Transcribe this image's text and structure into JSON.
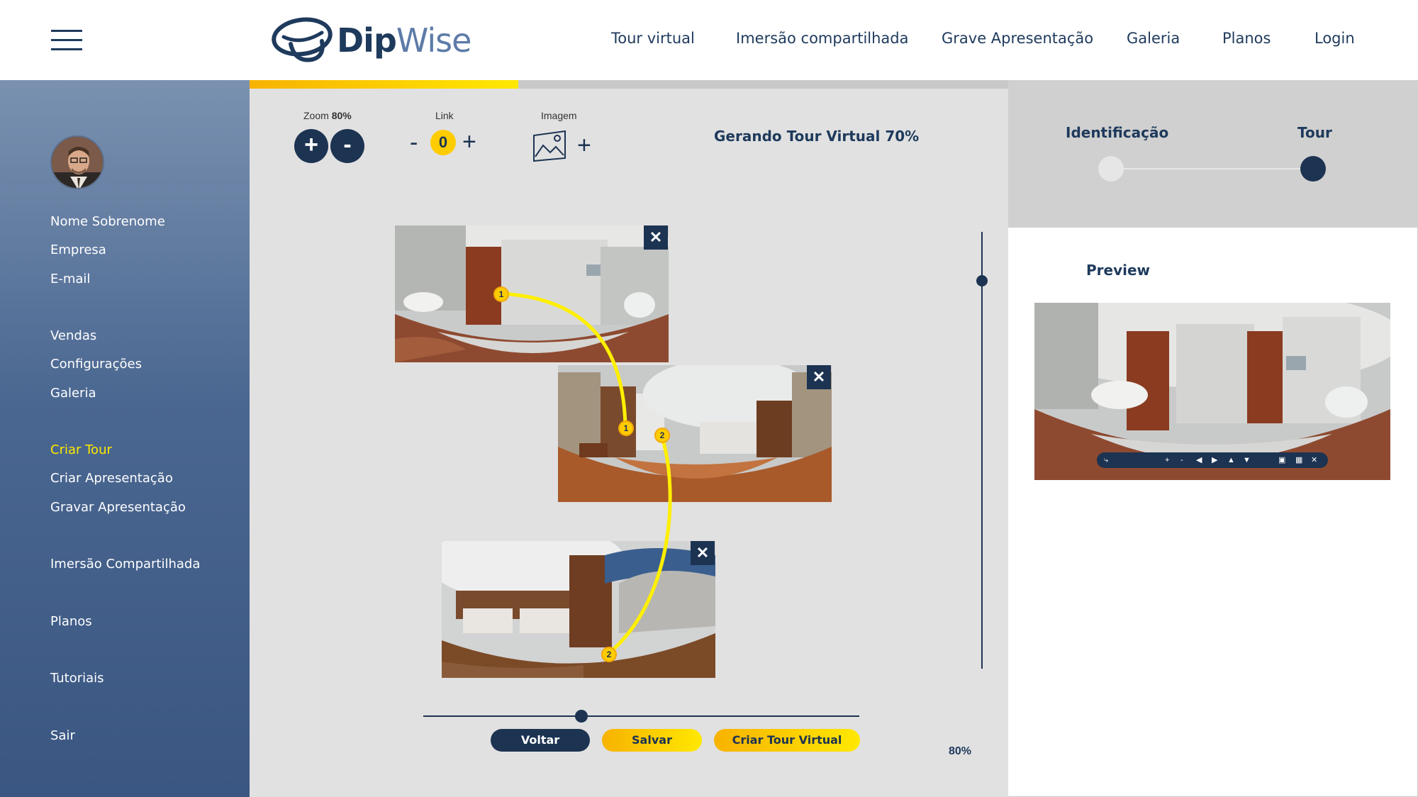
{
  "header": {
    "logo_main": "Dip",
    "logo_accent": "Wise",
    "nav": [
      {
        "label": "Tour virtual"
      },
      {
        "label": "Imersão compartilhada"
      },
      {
        "label": "Grave Apresentação"
      },
      {
        "label": "Galeria"
      },
      {
        "label": "Planos"
      },
      {
        "label": "Login"
      }
    ]
  },
  "sidebar": {
    "items": [
      {
        "label": "Nome Sobrenome"
      },
      {
        "label": "Empresa"
      },
      {
        "label": "E-mail"
      },
      {
        "label": "Vendas"
      },
      {
        "label": "Configurações"
      },
      {
        "label": "Galeria"
      },
      {
        "label": "Criar Tour",
        "active": true
      },
      {
        "label": "Criar Apresentação"
      },
      {
        "label": "Gravar Apresentação"
      },
      {
        "label": "Imersão Compartilhada"
      },
      {
        "label": "Planos"
      },
      {
        "label": "Tutoriais"
      },
      {
        "label": "Sair"
      }
    ]
  },
  "toolbar": {
    "zoom_label": "Zoom",
    "zoom_value": "80%",
    "zoom_in": "+",
    "zoom_out": "-",
    "link_label": "Link",
    "link_minus": "-",
    "link_count": "0",
    "link_plus": "+",
    "image_label": "Imagem",
    "image_plus": "+"
  },
  "progress": {
    "fraction": 0.7,
    "status_text": "Gerando Tour Virtual 70%"
  },
  "panoramas": [
    {
      "close": "✕",
      "pins": [
        "1"
      ]
    },
    {
      "close": "✕",
      "pins": [
        "1",
        "2"
      ]
    },
    {
      "close": "✕",
      "pins": [
        "2"
      ]
    }
  ],
  "actions": {
    "back": "Voltar",
    "save": "Salvar",
    "create": "Criar Tour Virtual"
  },
  "zoom_readout": "80%",
  "steps": {
    "step1": "Identificação",
    "step2": "Tour",
    "current": 2
  },
  "preview": {
    "title": "Preview",
    "controls": [
      "share",
      "+",
      "-",
      "◀",
      "▶",
      "▲",
      "▼",
      "vr",
      "fullscreen",
      "✕"
    ]
  },
  "colors": {
    "navy": "#1c3352",
    "accent_yellow": "#ffe800",
    "accent_orange": "#f7b200",
    "workspace_bg": "#e1e1e1"
  }
}
